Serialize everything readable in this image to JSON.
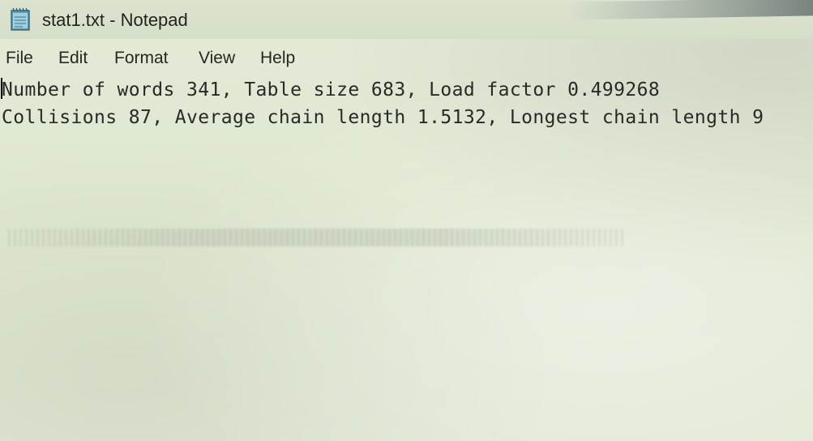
{
  "window": {
    "title": "stat1.txt - Notepad"
  },
  "menu": {
    "file": "File",
    "edit": "Edit",
    "format": "Format",
    "view": "View",
    "help": "Help"
  },
  "editor": {
    "lines": [
      "Number of words 341, Table size 683, Load factor 0.499268",
      "Collisions 87, Average chain length 1.5132, Longest chain length 9"
    ]
  },
  "icons": {
    "app": "notepad-icon"
  },
  "colors": {
    "background": "#dfe7d2",
    "text": "#262b27"
  }
}
